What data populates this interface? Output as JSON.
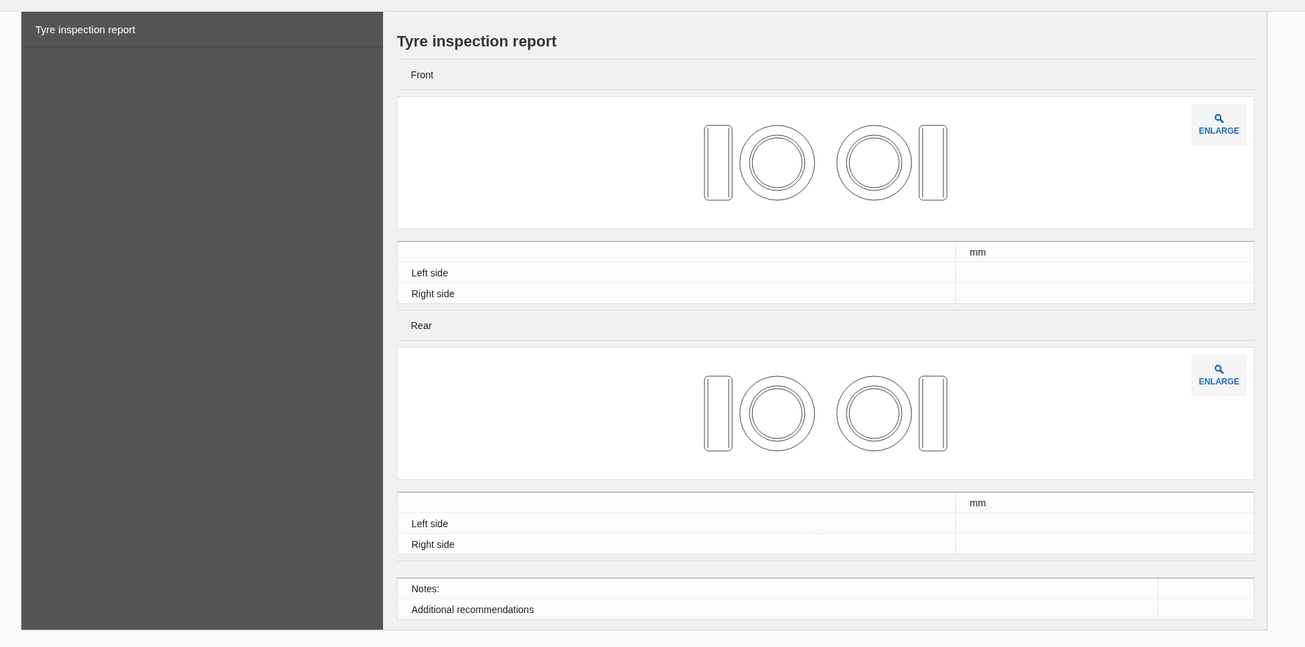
{
  "sidebar": {
    "title": "Tyre inspection report"
  },
  "report": {
    "title": "Tyre inspection report",
    "axles": [
      {
        "label": "Front",
        "enlarge": "ENLARGE",
        "unit": "mm",
        "rows": [
          "Left side",
          "Right side"
        ]
      },
      {
        "label": "Rear",
        "enlarge": "ENLARGE",
        "unit": "mm",
        "rows": [
          "Left side",
          "Right side"
        ]
      }
    ],
    "notes": [
      "Notes:",
      "Additional recommendations"
    ]
  }
}
